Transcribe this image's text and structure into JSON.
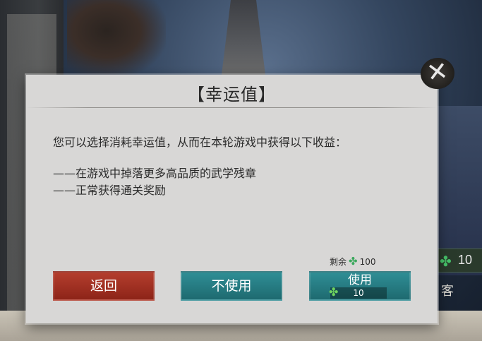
{
  "dialog": {
    "title": "【幸运值】",
    "description": "您可以选择消耗幸运值，从而在本轮游戏中获得以下收益：",
    "benefits": [
      "——在游戏中掉落更多高品质的武学残章",
      "——正常获得通关奖励"
    ],
    "remaining_label": "剩余",
    "remaining_value": "100",
    "buttons": {
      "back": "返回",
      "no_use": "不使用",
      "use": "使用",
      "use_cost": "10"
    }
  },
  "background": {
    "right_bar_value": "10",
    "right_char": "客"
  },
  "icons": {
    "luck": "clover-icon",
    "close": "close-icon"
  },
  "colors": {
    "back_button": "#a3352a",
    "teal_button": "#277c82",
    "clover": "#3aa85c",
    "dialog_bg": "#d8d7d6"
  }
}
